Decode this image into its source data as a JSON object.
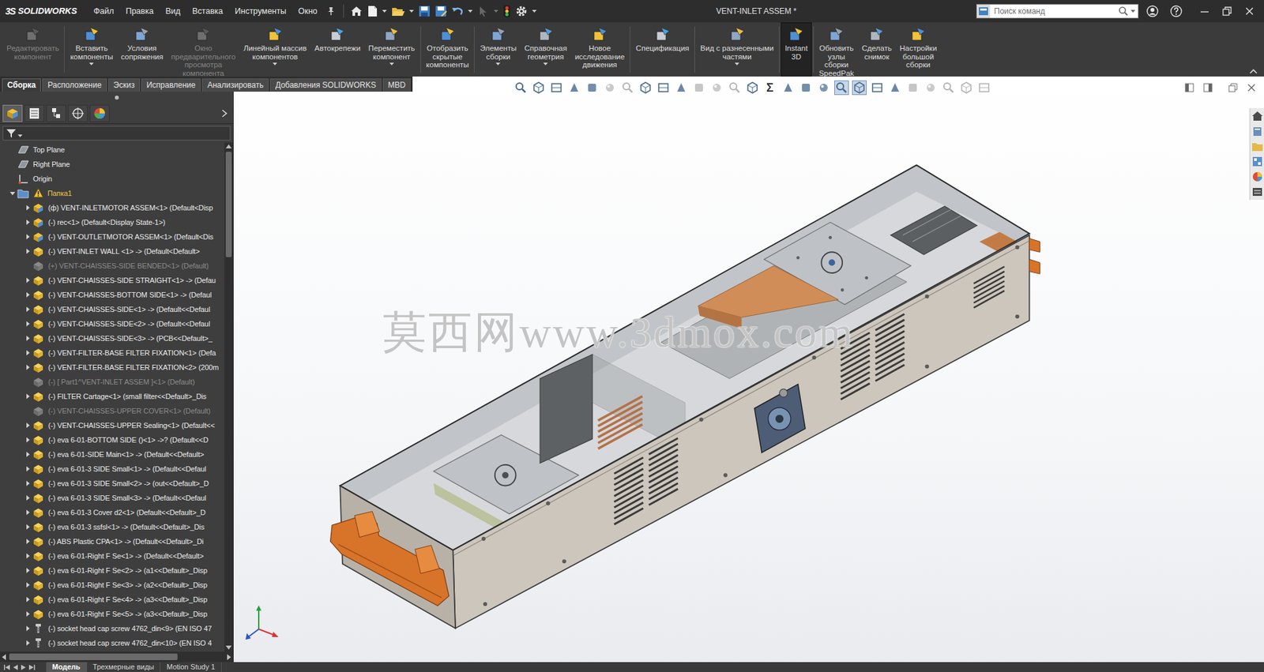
{
  "window": {
    "logo_mark": "3S",
    "logo": "SOLIDWORKS",
    "title": "VENT-INLET ASSEM *"
  },
  "menu": [
    "Файл",
    "Правка",
    "Вид",
    "Вставка",
    "Инструменты",
    "Окно"
  ],
  "search": {
    "placeholder": "Поиск команд"
  },
  "ribbon": [
    {
      "lines": [
        "Редактировать",
        "компонент"
      ],
      "disabled": true,
      "selected": false,
      "dropdown": false
    },
    {
      "lines": [
        "Вставить",
        "компоненты"
      ],
      "disabled": false,
      "selected": false,
      "dropdown": true
    },
    {
      "lines": [
        "Условия",
        "сопряжения"
      ],
      "disabled": false,
      "selected": false,
      "dropdown": false
    },
    {
      "lines": [
        "Окно",
        "предварительного",
        "просмотра",
        "компонента"
      ],
      "disabled": true,
      "selected": false,
      "dropdown": false
    },
    {
      "lines": [
        "Линейный массив",
        "компонентов"
      ],
      "disabled": false,
      "selected": false,
      "dropdown": true
    },
    {
      "lines": [
        "Автокрепежи"
      ],
      "disabled": false,
      "selected": false,
      "dropdown": false
    },
    {
      "lines": [
        "Переместить",
        "компонент"
      ],
      "disabled": false,
      "selected": false,
      "dropdown": true
    },
    {
      "lines": [
        "Отобразить",
        "скрытые",
        "компоненты"
      ],
      "disabled": false,
      "selected": false,
      "dropdown": false
    },
    {
      "lines": [
        "Элементы",
        "сборки"
      ],
      "disabled": false,
      "selected": false,
      "dropdown": true
    },
    {
      "lines": [
        "Справочная",
        "геометрия"
      ],
      "disabled": false,
      "selected": false,
      "dropdown": true
    },
    {
      "lines": [
        "Новое",
        "исследование",
        "движения"
      ],
      "disabled": false,
      "selected": false,
      "dropdown": false
    },
    {
      "lines": [
        "Спецификация"
      ],
      "disabled": false,
      "selected": false,
      "dropdown": false
    },
    {
      "lines": [
        "Вид с разнесенными",
        "частями"
      ],
      "disabled": false,
      "selected": false,
      "dropdown": true
    },
    {
      "lines": [
        "Instant",
        "3D"
      ],
      "disabled": false,
      "selected": true,
      "dropdown": false
    },
    {
      "lines": [
        "Обновить",
        "узлы",
        "сборки",
        "SpeedPak"
      ],
      "disabled": false,
      "selected": false,
      "dropdown": false
    },
    {
      "lines": [
        "Сделать",
        "снимок"
      ],
      "disabled": false,
      "selected": false,
      "dropdown": false
    },
    {
      "lines": [
        "Настройки",
        "большой",
        "сборки"
      ],
      "disabled": false,
      "selected": false,
      "dropdown": false
    }
  ],
  "command_tabs": [
    {
      "label": "Сборка",
      "selected": true
    },
    {
      "label": "Расположение",
      "selected": false
    },
    {
      "label": "Эскиз",
      "selected": false
    },
    {
      "label": "Исправление",
      "selected": false
    },
    {
      "label": "Анализировать",
      "selected": false
    },
    {
      "label": "Добавления SOLIDWORKS",
      "selected": false
    },
    {
      "label": "MBD",
      "selected": false
    }
  ],
  "panel_tabs": [
    {
      "selected": true
    },
    {
      "selected": false
    },
    {
      "selected": false
    },
    {
      "selected": false
    },
    {
      "selected": false
    }
  ],
  "tree_scroll_level": 0,
  "tree_hscroll_level": 0,
  "tree": [
    {
      "text": "Top Plane",
      "kind": "plane",
      "depth": 0,
      "suppressed": false
    },
    {
      "text": "Right Plane",
      "kind": "plane",
      "depth": 0,
      "suppressed": false
    },
    {
      "text": "Origin",
      "kind": "origin",
      "depth": 0,
      "suppressed": false
    },
    {
      "text": "Папка1",
      "kind": "folder",
      "depth": 0,
      "expanded": true,
      "warning": true,
      "suppressed": false
    },
    {
      "text": "(ф) VENT-INLETMOTOR ASSEM<1> (Default<Disp",
      "kind": "assembly",
      "depth": 1,
      "expanded": false,
      "suppressed": false
    },
    {
      "text": "(-) rec<1> (Default<Display State-1>)",
      "kind": "assembly",
      "depth": 1,
      "expanded": false,
      "suppressed": false
    },
    {
      "text": "(-) VENT-OUTLETMOTOR ASSEM<1> (Default<Dis",
      "kind": "assembly",
      "depth": 1,
      "expanded": false,
      "suppressed": false
    },
    {
      "text": "(-) VENT-INLET WALL <1> -> (Default<Default>",
      "kind": "part",
      "depth": 1,
      "expanded": false,
      "suppressed": false
    },
    {
      "text": "(+) VENT-CHAISSES-SIDE BENDED<1> (Default)",
      "kind": "part",
      "depth": 1,
      "suppressed": true
    },
    {
      "text": "(-) VENT-CHAISSES-SIDE STRAIGHT<1> -> (Defau",
      "kind": "part",
      "depth": 1,
      "expanded": false,
      "suppressed": false
    },
    {
      "text": "(-) VENT-CHAISSES-BOTTOM SIDE<1> -> (Defaul",
      "kind": "part",
      "depth": 1,
      "expanded": false,
      "suppressed": false
    },
    {
      "text": "(-) VENT-CHAISSES-SIDE<1> -> (Default<<Defaul",
      "kind": "part",
      "depth": 1,
      "expanded": false,
      "suppressed": false
    },
    {
      "text": "(-) VENT-CHAISSES-SIDE<2> -> (Default<<Defaul",
      "kind": "part",
      "depth": 1,
      "expanded": false,
      "suppressed": false
    },
    {
      "text": "(-) VENT-CHAISSES-SIDE<3> -> (PCB<<Default>_",
      "kind": "part",
      "depth": 1,
      "expanded": false,
      "suppressed": false
    },
    {
      "text": "(-) VENT-FILTER-BASE FILTER FIXATION<1> (Defa",
      "kind": "part",
      "depth": 1,
      "expanded": false,
      "suppressed": false
    },
    {
      "text": "(-) VENT-FILTER-BASE FILTER FIXATION<2> (200m",
      "kind": "part",
      "depth": 1,
      "expanded": false,
      "suppressed": false
    },
    {
      "text": "(-) [ Part1^VENT-INLET ASSEM ]<1> (Default)",
      "kind": "part",
      "depth": 1,
      "suppressed": true
    },
    {
      "text": "(-) FILTER Cartage<1> (small filter<<Default>_Dis",
      "kind": "part",
      "depth": 1,
      "expanded": false,
      "suppressed": false
    },
    {
      "text": "(-) VENT-CHAISSES-UPPER COVER<1> (Default)",
      "kind": "part",
      "depth": 1,
      "suppressed": true
    },
    {
      "text": "(-) VENT-CHAISSES-UPPER Sealing<1> (Default<<",
      "kind": "part",
      "depth": 1,
      "expanded": false,
      "suppressed": false
    },
    {
      "text": "(-) eva 6-01-BOTTOM SIDE ()<1> ->? (Default<<D",
      "kind": "part",
      "depth": 1,
      "expanded": false,
      "suppressed": false
    },
    {
      "text": "(-) eva 6-01-SIDE Main<1> -> (Default<<Default>",
      "kind": "part",
      "depth": 1,
      "expanded": false,
      "suppressed": false
    },
    {
      "text": "(-) eva 6-01-3 SIDE Small<1> -> (Default<<Defaul",
      "kind": "part",
      "depth": 1,
      "expanded": false,
      "suppressed": false
    },
    {
      "text": "(-) eva 6-01-3 SIDE Small<2> -> (out<<Default>_D",
      "kind": "part",
      "depth": 1,
      "expanded": false,
      "suppressed": false
    },
    {
      "text": "(-) eva 6-01-3 SIDE Small<3> -> (Default<<Defaul",
      "kind": "part",
      "depth": 1,
      "expanded": false,
      "suppressed": false
    },
    {
      "text": "(-) eva 6-01-3 Cover d2<1> (Default<<Default>_D",
      "kind": "part",
      "depth": 1,
      "expanded": false,
      "suppressed": false
    },
    {
      "text": "(-) eva 6-01-3 ssfsl<1> -> (Default<<Default>_Dis",
      "kind": "part",
      "depth": 1,
      "expanded": false,
      "suppressed": false
    },
    {
      "text": "(-) ABS Plastic CPA<1> -> (Default<<Default>_Di",
      "kind": "part",
      "depth": 1,
      "expanded": false,
      "suppressed": false
    },
    {
      "text": "(-) eva 6-01-Right F Se<1> -> (Default<<Default>",
      "kind": "part",
      "depth": 1,
      "expanded": false,
      "suppressed": false
    },
    {
      "text": "(-) eva 6-01-Right F Se<2> -> (a1<<Default>_Disp",
      "kind": "part",
      "depth": 1,
      "expanded": false,
      "suppressed": false
    },
    {
      "text": "(-) eva 6-01-Right F Se<3> -> (a2<<Default>_Disp",
      "kind": "part",
      "depth": 1,
      "expanded": false,
      "suppressed": false
    },
    {
      "text": "(-) eva 6-01-Right F Se<4> -> (a3<<Default>_Disp",
      "kind": "part",
      "depth": 1,
      "expanded": false,
      "suppressed": false
    },
    {
      "text": "(-) eva 6-01-Right F Se<5> -> (a3<<Default>_Disp",
      "kind": "part",
      "depth": 1,
      "expanded": false,
      "suppressed": false
    },
    {
      "text": "(-) socket head cap screw 4762_din<9> (EN ISO 47",
      "kind": "screw",
      "depth": 1,
      "expanded": false,
      "suppressed": false
    },
    {
      "text": "(-) socket head cap screw 4762_din<10> (EN ISO 4",
      "kind": "screw",
      "depth": 1,
      "expanded": false,
      "suppressed": false
    }
  ],
  "headsup": [
    {
      "selected": false,
      "disabled": false
    },
    {
      "selected": false,
      "disabled": false
    },
    {
      "selected": false,
      "disabled": false
    },
    {
      "selected": false,
      "disabled": false
    },
    {
      "selected": false,
      "disabled": false
    },
    {
      "selected": false,
      "disabled": true
    },
    {
      "selected": false,
      "disabled": true
    },
    {
      "selected": false,
      "disabled": false
    },
    {
      "selected": false,
      "disabled": false
    },
    {
      "selected": false,
      "disabled": false
    },
    {
      "selected": false,
      "disabled": true
    },
    {
      "selected": false,
      "disabled": true
    },
    {
      "selected": false,
      "disabled": true
    },
    {
      "selected": false,
      "disabled": false
    },
    {
      "selected": false,
      "disabled": false,
      "text": "Σ"
    },
    {
      "selected": false,
      "disabled": false
    },
    {
      "selected": false,
      "disabled": false
    },
    {
      "selected": false,
      "disabled": false
    },
    {
      "selected": true,
      "disabled": false
    },
    {
      "selected": true,
      "disabled": false
    },
    {
      "selected": false,
      "disabled": false
    },
    {
      "selected": false,
      "disabled": false
    },
    {
      "selected": false,
      "disabled": true
    },
    {
      "selected": false,
      "disabled": true
    },
    {
      "selected": false,
      "disabled": true
    },
    {
      "selected": false,
      "disabled": true
    },
    {
      "selected": false,
      "disabled": true
    }
  ],
  "watermark": "莫西网www.3dmox.com",
  "bottom_tabs": [
    {
      "label": "Модель",
      "selected": true
    },
    {
      "label": "Трехмерные виды",
      "selected": false
    },
    {
      "label": "Motion Study 1",
      "selected": false
    }
  ]
}
